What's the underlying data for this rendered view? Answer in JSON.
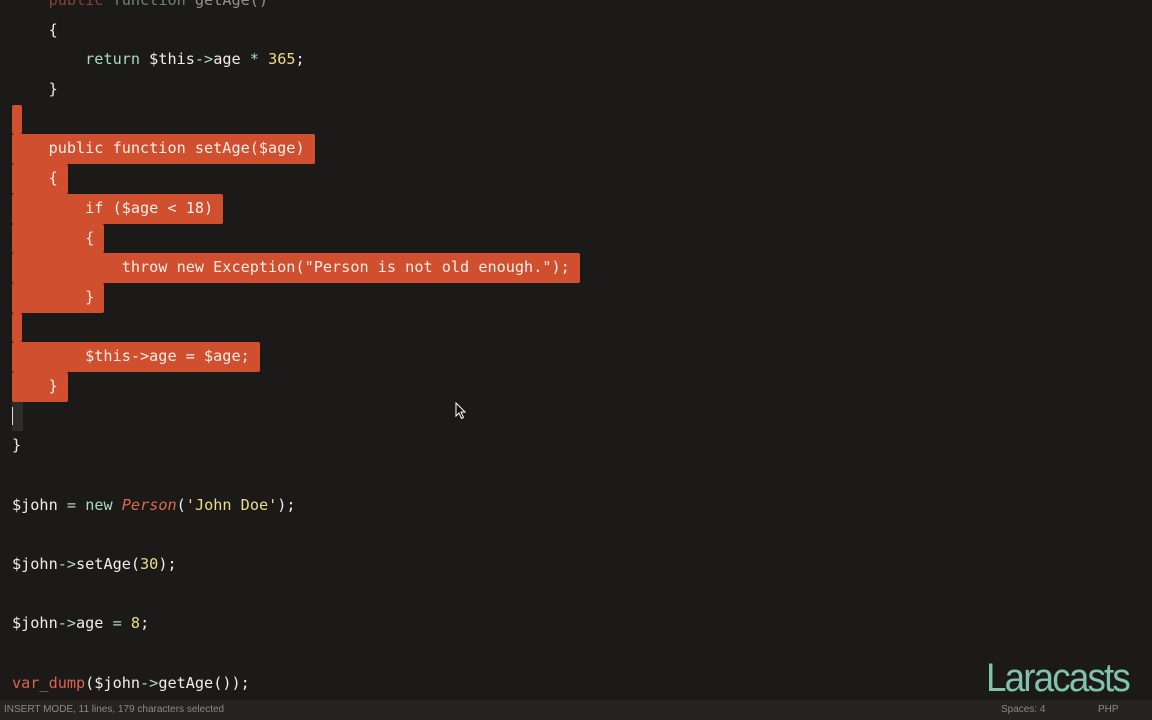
{
  "editor": {
    "lines": [
      {
        "tokens": [
          [
            "    ",
            ""
          ],
          [
            "public",
            "kw dim"
          ],
          [
            " ",
            ""
          ],
          [
            "function",
            "fn dim"
          ],
          [
            " getAge()",
            "dim"
          ]
        ]
      },
      {
        "tokens": [
          [
            "    {",
            ""
          ]
        ]
      },
      {
        "tokens": [
          [
            "        ",
            ""
          ],
          [
            "return",
            "fn"
          ],
          [
            " $this",
            ""
          ],
          [
            "->",
            "op"
          ],
          [
            "age ",
            ""
          ],
          [
            "*",
            "op"
          ],
          [
            " ",
            ""
          ],
          [
            "365",
            "num"
          ],
          [
            ";",
            ""
          ]
        ]
      },
      {
        "tokens": [
          [
            "    }",
            ""
          ]
        ]
      },
      {
        "selected": true,
        "tokens": []
      },
      {
        "selected": true,
        "tokens": [
          [
            "    public function setAge($age)",
            ""
          ]
        ]
      },
      {
        "selected": true,
        "tokens": [
          [
            "    {",
            ""
          ]
        ]
      },
      {
        "selected": true,
        "tokens": [
          [
            "        if ($age < 18)",
            ""
          ]
        ]
      },
      {
        "selected": true,
        "tokens": [
          [
            "        {",
            ""
          ]
        ]
      },
      {
        "selected": true,
        "tokens": [
          [
            "            throw new Exception(\"Person is not old enough.\");",
            ""
          ]
        ]
      },
      {
        "selected": true,
        "tokens": [
          [
            "        }",
            ""
          ]
        ]
      },
      {
        "selected": true,
        "tokens": []
      },
      {
        "selected": true,
        "tokens": [
          [
            "        $this->age = $age;",
            ""
          ]
        ]
      },
      {
        "selected": true,
        "tokens": [
          [
            "    }",
            ""
          ]
        ]
      },
      {
        "cursor": true,
        "tokens": []
      },
      {
        "tokens": [
          [
            "}",
            ""
          ]
        ]
      },
      {
        "tokens": []
      },
      {
        "tokens": [
          [
            "$john ",
            ""
          ],
          [
            "=",
            "op"
          ],
          [
            " ",
            ""
          ],
          [
            "new",
            "fn"
          ],
          [
            " ",
            ""
          ],
          [
            "Person",
            "cls"
          ],
          [
            "(",
            ""
          ],
          [
            "'John Doe'",
            "str"
          ],
          [
            ");",
            ""
          ]
        ]
      },
      {
        "tokens": []
      },
      {
        "tokens": [
          [
            "$john",
            ""
          ],
          [
            "->",
            "op"
          ],
          [
            "setAge(",
            ""
          ],
          [
            "30",
            "num"
          ],
          [
            ");",
            ""
          ]
        ]
      },
      {
        "tokens": []
      },
      {
        "tokens": [
          [
            "$john",
            ""
          ],
          [
            "->",
            "op"
          ],
          [
            "age ",
            ""
          ],
          [
            "=",
            "op"
          ],
          [
            " ",
            ""
          ],
          [
            "8",
            "num"
          ],
          [
            ";",
            ""
          ]
        ]
      },
      {
        "tokens": []
      },
      {
        "tokens": [
          [
            "var_dump",
            "call"
          ],
          [
            "($john",
            ""
          ],
          [
            "->",
            "op"
          ],
          [
            "getAge());",
            ""
          ]
        ]
      }
    ]
  },
  "status": {
    "mode": "INSERT MODE, 11 lines, 179 characters selected",
    "spaces": "Spaces: 4",
    "language": "PHP"
  },
  "logo": "Laracasts",
  "colors": {
    "selection": "#cf4f2e",
    "background": "#1c1a19",
    "logo": "#80c2ad"
  }
}
